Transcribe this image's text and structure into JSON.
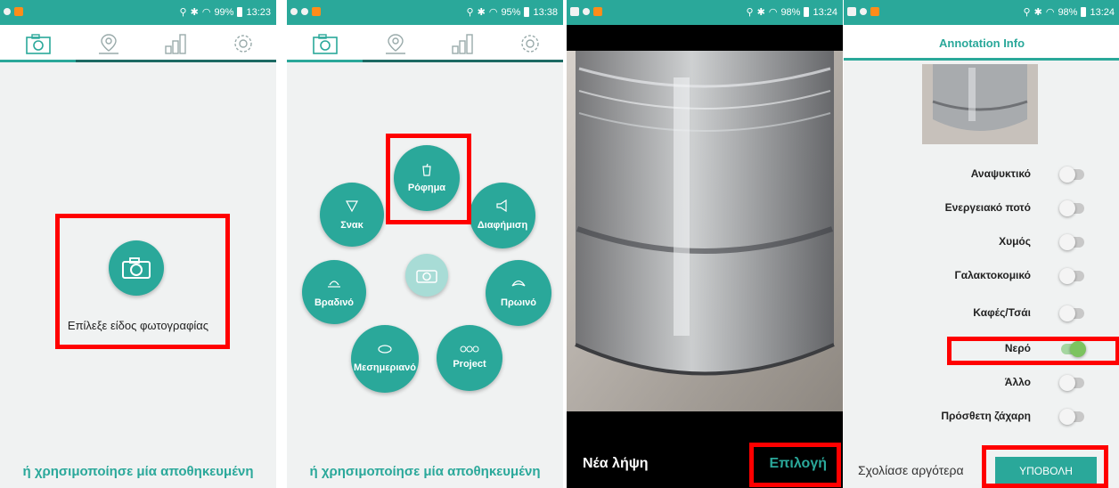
{
  "screen1": {
    "status_time": "13:23",
    "status_battery": "99%",
    "choose_label": "Επίλεξε είδος φωτογραφίας",
    "saved_link": "ή χρησιμοποίησε μία αποθηκευμένη"
  },
  "screen2": {
    "status_time": "13:38",
    "status_battery": "95%",
    "categories": {
      "rofima": "Ρόφημα",
      "snak": "Σνακ",
      "diafimisi": "Διαφήμιση",
      "vradino": "Βραδινό",
      "proino": "Πρωινό",
      "mesimeriano": "Μεσημεριανό",
      "project": "Project"
    },
    "saved_link": "ή χρησιμοποίησε μία αποθηκευμένη"
  },
  "screen3": {
    "status_time": "13:24",
    "status_battery": "98%",
    "retake_label": "Νέα λήψη",
    "select_label": "Επιλογή"
  },
  "screen4": {
    "status_time": "13:24",
    "status_battery": "98%",
    "header_title": "Annotation Info",
    "options": [
      {
        "label": "Αναψυκτικό",
        "on": false
      },
      {
        "label": "Ενεργειακό ποτό",
        "on": false
      },
      {
        "label": "Χυμός",
        "on": false
      },
      {
        "label": "Γαλακτοκομικό",
        "on": false
      },
      {
        "label": "Καφές/Τσάι",
        "on": false
      },
      {
        "label": "Νερό",
        "on": true
      },
      {
        "label": "Άλλο",
        "on": false
      },
      {
        "label": "Πρόσθετη ζάχαρη",
        "on": false
      }
    ],
    "later_label": "Σχολίασε αργότερα",
    "submit_label": "ΥΠΟΒΟΛΗ"
  },
  "colors": {
    "accent": "#2aa89a",
    "highlight": "#ff0000"
  }
}
